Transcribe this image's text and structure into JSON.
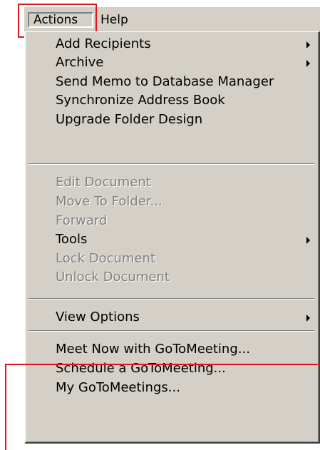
{
  "menubar": {
    "actions_label": "Actions",
    "help_label": "Help"
  },
  "menu": {
    "items": [
      {
        "label": "Add Recipients",
        "enabled": true,
        "submenu": true
      },
      {
        "label": "Archive",
        "enabled": true,
        "submenu": true
      },
      {
        "label": "Send Memo to Database Manager",
        "enabled": true,
        "submenu": false
      },
      {
        "label": "Synchronize Address Book",
        "enabled": true,
        "submenu": false
      },
      {
        "label": "Upgrade Folder Design",
        "enabled": true,
        "submenu": false
      },
      {
        "label": "Edit Document",
        "enabled": false,
        "submenu": false
      },
      {
        "label": "Move To Folder...",
        "enabled": false,
        "submenu": false
      },
      {
        "label": "Forward",
        "enabled": false,
        "submenu": false
      },
      {
        "label": "Tools",
        "enabled": true,
        "submenu": true
      },
      {
        "label": "Lock Document",
        "enabled": false,
        "submenu": false
      },
      {
        "label": "Unlock Document",
        "enabled": false,
        "submenu": false
      },
      {
        "label": "View Options",
        "enabled": true,
        "submenu": true
      },
      {
        "label": "Meet Now with GoToMeeting...",
        "enabled": true,
        "submenu": false
      },
      {
        "label": "Schedule a GoToMeeting...",
        "enabled": true,
        "submenu": false
      },
      {
        "label": "My GoToMeetings...",
        "enabled": true,
        "submenu": false
      }
    ]
  },
  "colors": {
    "menu_bg": "#d4d0c8",
    "disabled_text": "#808080",
    "highlight": "#e0141c"
  },
  "icons": {
    "submenu": "submenu-arrow-icon"
  }
}
